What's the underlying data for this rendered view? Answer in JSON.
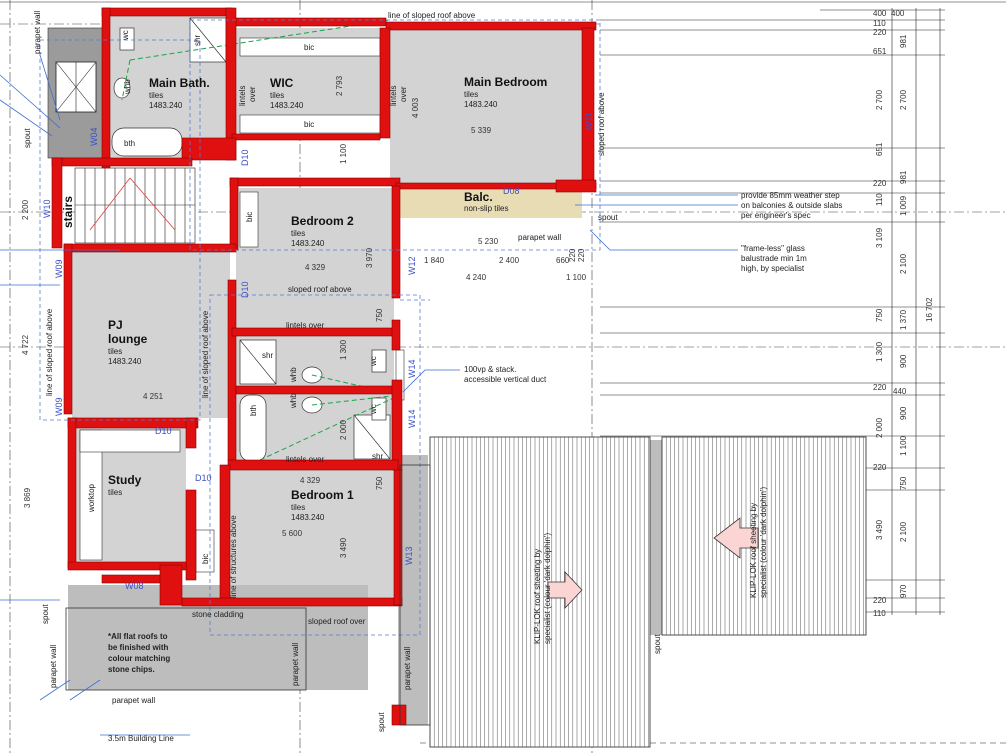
{
  "rooms": {
    "main_bath": {
      "name": "Main Bath.",
      "finish": "tiles",
      "code": "1483.240"
    },
    "wic": {
      "name": "WIC",
      "finish": "tiles",
      "code": "1483.240"
    },
    "main_bedroom": {
      "name": "Main Bedroom",
      "finish": "tiles",
      "code": "1483.240"
    },
    "balcony": {
      "name": "Balc.",
      "finish": "non-slip tiles"
    },
    "bedroom2": {
      "name": "Bedroom 2",
      "finish": "tiles",
      "code": "1483.240"
    },
    "pj_lounge": {
      "name_line1": "PJ",
      "name_line2": "lounge",
      "finish": "tiles",
      "code": "1483.240"
    },
    "study": {
      "name": "Study",
      "finish": "tiles"
    },
    "bedroom1": {
      "name": "Bedroom 1",
      "finish": "tiles",
      "code": "1483.240"
    },
    "stairs": {
      "name": "stairs"
    }
  },
  "fixtures": {
    "shr": "shr",
    "whb": "whb",
    "wc": "wc",
    "bth": "bth",
    "bic": "bic",
    "worktop": "worktop",
    "lintels_over": "lintels over",
    "lintels": "lintels",
    "over": "over"
  },
  "openings": {
    "W04": "W04",
    "W10": "W10",
    "W09a": "W09",
    "W09b": "W09",
    "W08": "W08",
    "W11": "W11",
    "W12": "W12",
    "W13": "W13",
    "W14a": "W14",
    "W14b": "W14",
    "D08": "D08",
    "D10a": "D10",
    "D10b": "D10",
    "D10c": "D10",
    "D10d": "D10"
  },
  "annotations": {
    "sloped_roof_above_top": "line of sloped roof above",
    "sloped_roof_above_right": "sloped roof above",
    "sloped_roof_above_mid": "sloped roof above",
    "sloped_roof_above_lounge": "line of sloped roof above",
    "sloped_roof_above_left": "line of sloped roof above",
    "structures_above": "line of structures above",
    "sloped_roof_over": "sloped roof over",
    "stone_cladding": "stone cladding",
    "parapet_wall": "parapet wall",
    "spout": "spout",
    "building_line": "3.5m Building Line",
    "vp_stack_line1": "100vp &  stack.",
    "vp_stack_line2": "accessible vertical duct",
    "weather_step_1": "provide 85mm weather step",
    "weather_step_2": "on balconies & outside slabs",
    "weather_step_3": "per engineer's spec",
    "glass_1": "\"frame-less\" glass",
    "glass_2": "balustrade min 1m",
    "glass_3": "high, by specialist",
    "flat_roofs_1": "*All flat roofs to",
    "flat_roofs_2": "be finished with",
    "flat_roofs_3": "colour matching",
    "flat_roofs_4": "stone chips.",
    "kliplok_1": "KLIP-LOK roof sheeting by",
    "kliplok_2": "specialist (colour 'dark dolphin')"
  },
  "dimensions": {
    "d5339": "5 339",
    "d4003": "4 003",
    "d2793": "2 793",
    "d1100": "1 100",
    "d3970": "3 970",
    "d4329a": "4 329",
    "d4329b": "4 329",
    "d4251": "4 251",
    "d5600": "5 600",
    "d3490a": "3 490",
    "d750a": "750",
    "d750b": "750",
    "d1300": "1 300",
    "d2000": "2 000",
    "d3869": "3 869",
    "d4722": "4 722",
    "d2200": "2 200",
    "d5230": "5 230",
    "d1840": "1 840",
    "d2400": "2 400",
    "d660": "660",
    "d220": "220",
    "d220b": "220",
    "d4240": "4 240",
    "d1100b": "1 100",
    "r400a": "400",
    "r400b": "400",
    "r110": "110",
    "r220": "220",
    "r651": "651",
    "r981": "981",
    "r2700a": "2 700",
    "r2700b": "2 700",
    "r651b": "651",
    "r220b": "220",
    "r981b": "981",
    "r110b": "110",
    "r1009": "1 009",
    "r3109": "3 109",
    "r2100": "2 100",
    "r16702": "16 702",
    "r750": "750",
    "r1370": "1 370",
    "r1300": "1 300",
    "r900": "900",
    "r220c": "220",
    "r440": "440",
    "r900b": "900",
    "r2000": "2 000",
    "r1100": "1 100",
    "r220d": "220",
    "r750b": "750",
    "r3490": "3 490",
    "r2100b": "2 100",
    "r220e": "220",
    "r970": "970",
    "r110c": "110"
  }
}
